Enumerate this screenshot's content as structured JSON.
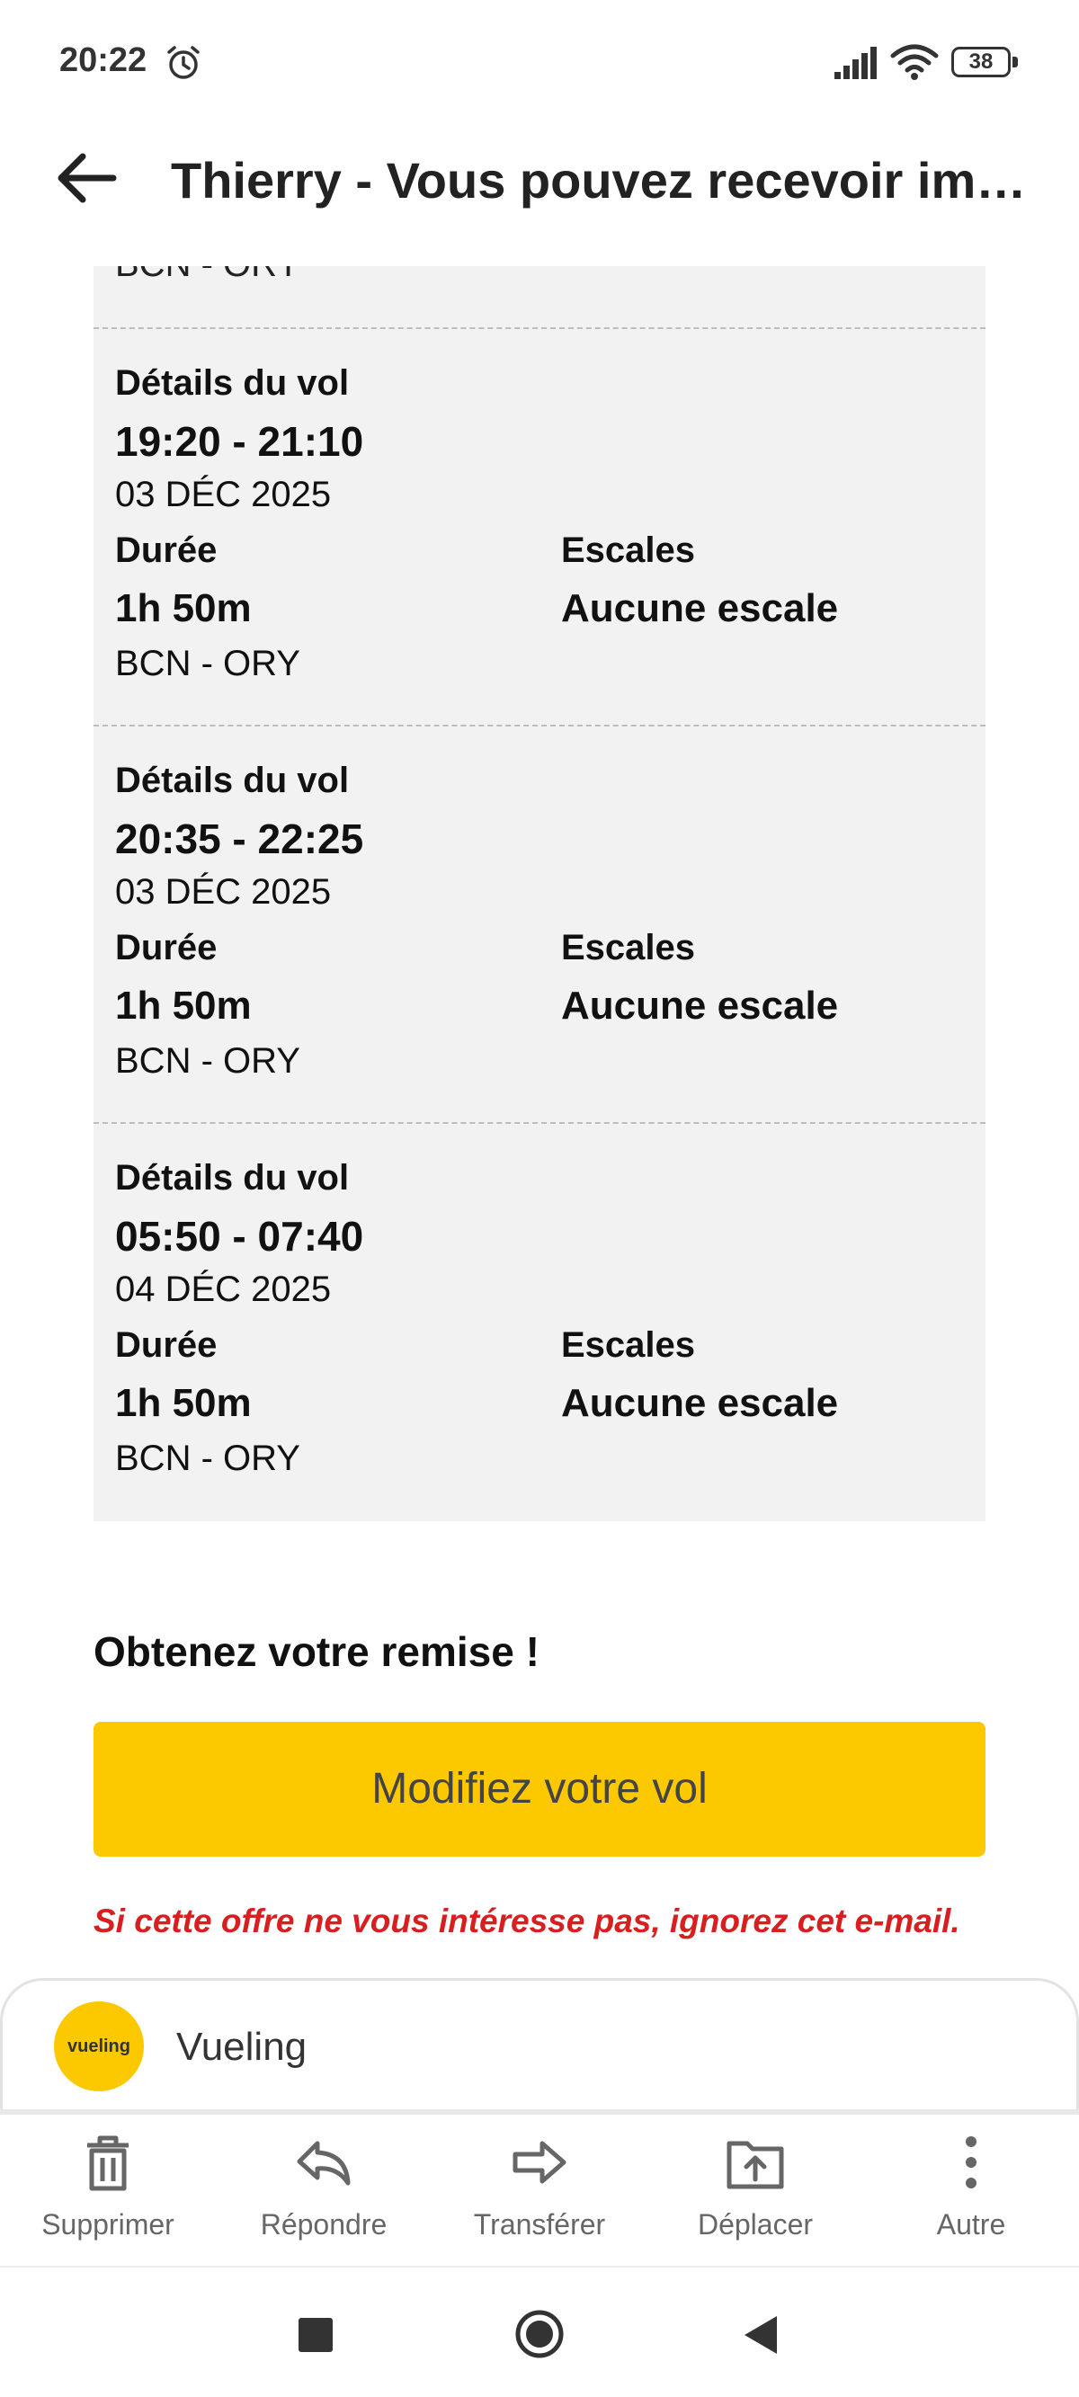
{
  "status_bar": {
    "time": "20:22",
    "battery": "38"
  },
  "header": {
    "subject": "Thierry - Vous pouvez recevoir immé..."
  },
  "partial_route": "BCN - ORY",
  "flights": [
    {
      "heading": "Détails du vol",
      "time": "19:20 - 21:10",
      "date": "03 DÉC 2025",
      "duration_label": "Durée",
      "duration": "1h 50m",
      "stops_label": "Escales",
      "stops": "Aucune escale",
      "route": "BCN - ORY"
    },
    {
      "heading": "Détails du vol",
      "time": "20:35 - 22:25",
      "date": "03 DÉC 2025",
      "duration_label": "Durée",
      "duration": "1h 50m",
      "stops_label": "Escales",
      "stops": "Aucune escale",
      "route": "BCN - ORY"
    },
    {
      "heading": "Détails du vol",
      "time": "05:50 - 07:40",
      "date": "04 DÉC 2025",
      "duration_label": "Durée",
      "duration": "1h 50m",
      "stops_label": "Escales",
      "stops": "Aucune escale",
      "route": "BCN - ORY"
    }
  ],
  "promo": {
    "title": "Obtenez votre remise !",
    "cta": "Modifiez votre vol",
    "disclaimer": "Si cette offre ne vous intéresse pas, ignorez cet e-mail."
  },
  "sender": {
    "avatar_text": "vueling",
    "name": "Vueling"
  },
  "actions": [
    {
      "label": "Supprimer",
      "icon": "trash-icon"
    },
    {
      "label": "Répondre",
      "icon": "reply-icon"
    },
    {
      "label": "Transférer",
      "icon": "forward-icon"
    },
    {
      "label": "Déplacer",
      "icon": "move-icon"
    },
    {
      "label": "Autre",
      "icon": "more-icon"
    }
  ],
  "colors": {
    "accent": "#fcc800",
    "warning": "#d81f1f",
    "panel": "#f2f2f2"
  }
}
